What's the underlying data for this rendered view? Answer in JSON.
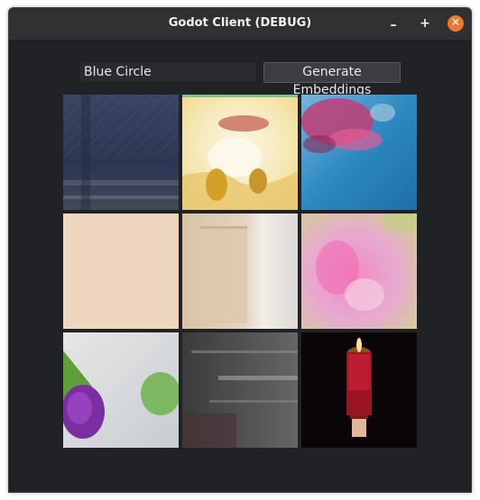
{
  "window": {
    "title": "Godot Client (DEBUG)",
    "controls": {
      "minimize_glyph": "–",
      "maximize_glyph": "+",
      "close_glyph": "✕"
    }
  },
  "search": {
    "value": "Blue Circle"
  },
  "generate_button": {
    "label": "Generate Embeddings"
  },
  "results": {
    "images": [
      {
        "subject": "blurry dark blue grid/wall"
      },
      {
        "subject": "yellow cream blurry figure"
      },
      {
        "subject": "pink flowers over blue water"
      },
      {
        "subject": "plain peach surface"
      },
      {
        "subject": "beige door/wall"
      },
      {
        "subject": "pink blurry flower"
      },
      {
        "subject": "purple and green fruit slices on white"
      },
      {
        "subject": "blurry grey metal rack"
      },
      {
        "subject": "red candle on black"
      }
    ]
  },
  "colors": {
    "window_bg": "#202225",
    "titlebar_bg": "#2f3133",
    "close_accent": "#f0762a"
  }
}
